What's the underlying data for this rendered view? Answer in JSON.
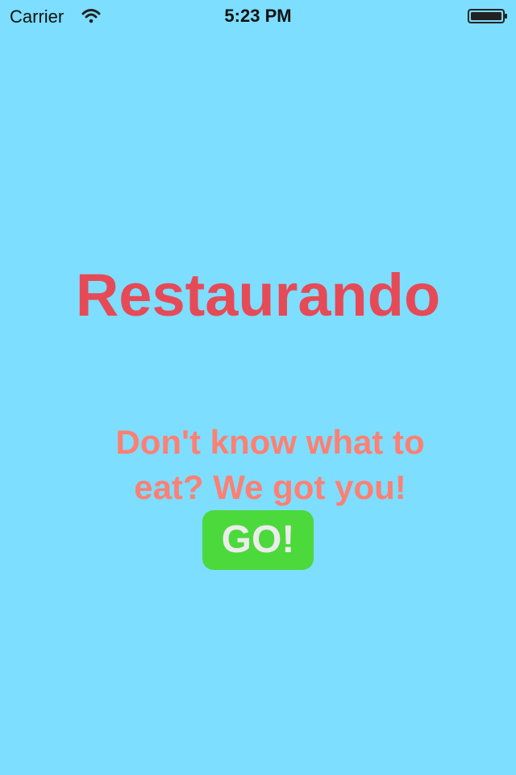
{
  "status_bar": {
    "carrier": "Carrier",
    "time": "5:23 PM",
    "wifi_icon": "wifi-icon",
    "battery_icon": "battery-icon"
  },
  "main": {
    "title": "Restaurando",
    "tagline": "Don't know what to eat? We got you!",
    "go_button_label": "GO!"
  },
  "colors": {
    "background": "#7ddeff",
    "title": "#e64a57",
    "tagline": "#ff7f73",
    "button": "#4cd93c",
    "button_text": "#ececec"
  }
}
